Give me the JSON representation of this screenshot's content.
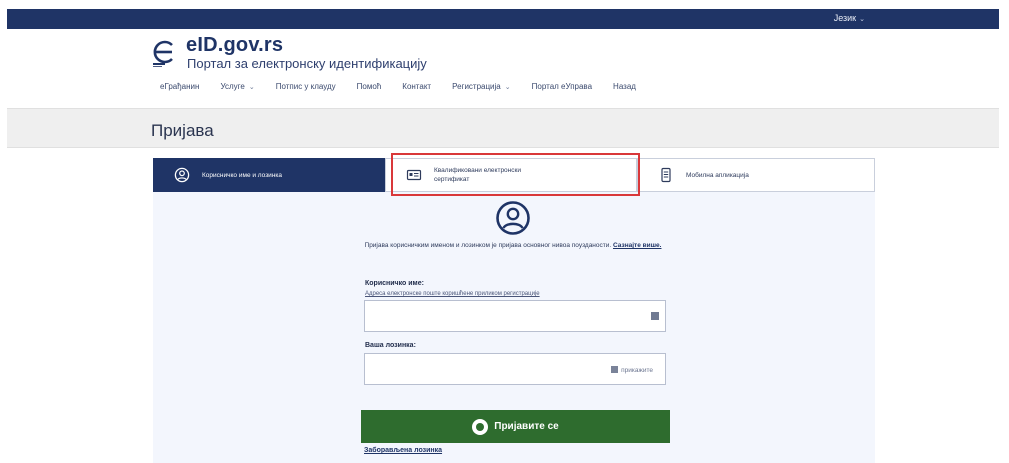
{
  "topbar": {
    "language": "Језик",
    "language_chevron": "⌄"
  },
  "brand": {
    "name": "eID.gov.rs",
    "tagline": "Портал за електронску идентификацију"
  },
  "nav": {
    "items": [
      {
        "label": "eГрађанин",
        "has_dropdown": false
      },
      {
        "label": "Услуге",
        "has_dropdown": true
      },
      {
        "label": "Потпис у клауду",
        "has_dropdown": false
      },
      {
        "label": "Помоћ",
        "has_dropdown": false
      },
      {
        "label": "Контакт",
        "has_dropdown": false
      },
      {
        "label": "Регистрација",
        "has_dropdown": true
      },
      {
        "label": "Портал eУправа",
        "has_dropdown": false
      },
      {
        "label": "Назад",
        "has_dropdown": false
      }
    ],
    "chevron": "⌄"
  },
  "page": {
    "title": "Пријава"
  },
  "tabs": [
    {
      "label": "Корисничко име и лозинка",
      "icon": "user-circle-icon",
      "active": true
    },
    {
      "label": "Квалификовани електронски сертификат",
      "icon": "certificate-card-icon",
      "active": false
    },
    {
      "label": "Мобилна апликација",
      "icon": "mobile-app-icon",
      "active": false
    }
  ],
  "login_form": {
    "info_text": "Пријава корисничким именом и лозинком је пријава основног нивоа поузданости.",
    "info_link": "Сазнајте више.",
    "username_label": "Корисничко име:",
    "username_hint": "Адреса електронске поште коришћене приликом регистрације",
    "username_value": "",
    "password_label": "Ваша лозинка:",
    "password_value": "",
    "show_password": "прикажите",
    "submit_label": "Пријавите се",
    "forgot_password": "Заборављена лозинка"
  },
  "colors": {
    "navy": "#1f3466",
    "green_button": "#2e6c2e",
    "highlight_red": "#d9383a",
    "card_bg": "#f3f6fd"
  }
}
